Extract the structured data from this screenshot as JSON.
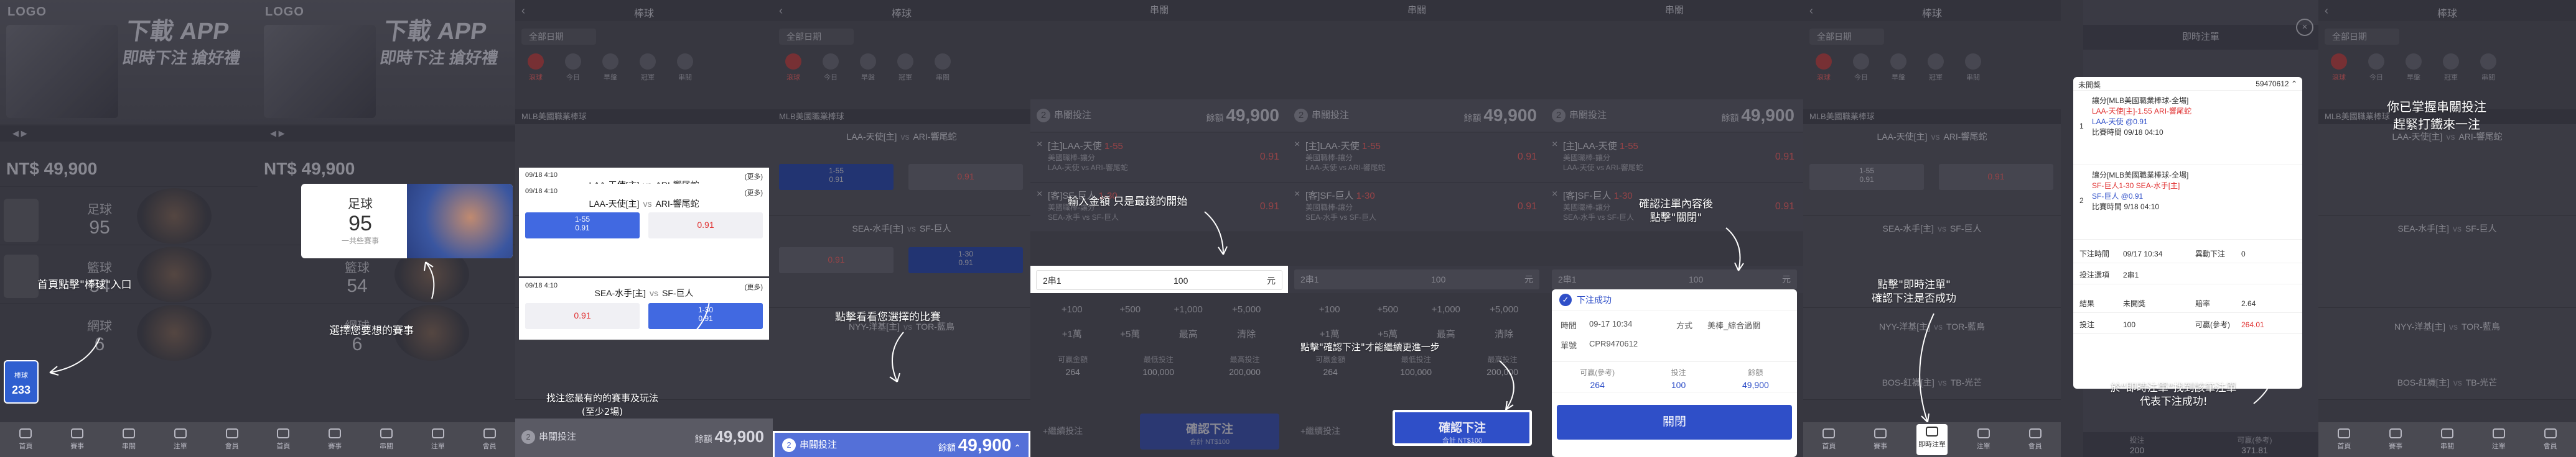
{
  "home": {
    "logo": "LOGO",
    "banner_line1": "下載 APP",
    "banner_line2": "即時下注 搶好禮",
    "balance": "NT$ 49,900",
    "categories": [
      {
        "name": "足球",
        "count": "95"
      },
      {
        "name": "籃球",
        "count": "54"
      },
      {
        "name": "網球",
        "count": "6"
      }
    ],
    "side_tab_label": "棒球",
    "side_tab_count": "233",
    "nav": [
      "首頁",
      "賽事",
      "串關",
      "注單",
      "會員"
    ],
    "popup": {
      "name": "足球",
      "count": "95",
      "sub": "一共些賽事"
    }
  },
  "annotations": {
    "a1": "首頁點擊\"棒球\"入口",
    "a2": "選擇您要想的賽事",
    "a3_line1": "找注您最有的的賽事及玩法",
    "a3_line2": "(至少2場)",
    "a4": "點擊看看您選擇的比賽",
    "a5": "輸入金額 只是最錢的開始",
    "a6": "點擊\"確認下注\"才能繼續更進一步",
    "a7_line1": "確認注單內容後",
    "a7_line2": "點擊\"關閉\"",
    "a8_line1": "點擊\"即時注單\"",
    "a8_line2": "確認下注是否成功",
    "a9_line1": "於\"即時注單\"找到該筆注單",
    "a9_line2": "代表下注成功!",
    "a10_line1": "你已掌握串關投注",
    "a10_line2": "趕緊打鐵來一注"
  },
  "sport": {
    "title": "棒球",
    "filter": "全部日期",
    "leagues": [
      "滾球",
      "今日",
      "早盤",
      "冠軍",
      "串關"
    ],
    "section": "MLB美國職業棒球",
    "match1": {
      "time": "09/18 4:10",
      "more": "(更多)",
      "home": "LAA-天使[主]",
      "away": "ARI-響尾蛇",
      "odds_a": "1-55",
      "odds_a_price": "0.91",
      "odds_b_price": "0.91"
    },
    "match2": {
      "time": "09/18 4:10",
      "more": "(更多)",
      "home": "SEA-水手[主]",
      "away": "SF-巨人",
      "odds_a_price": "0.91",
      "odds_b": "1-30",
      "odds_b_price": "0.91"
    },
    "match3": {
      "home": "NYY-洋基[主]",
      "away": "TOR-藍鳥"
    },
    "match4": {
      "home": "BOS-紅襪[主]",
      "away": "TB-光芒"
    },
    "slip_count": "2",
    "slip_label": "串關投注",
    "slip_amount_label": "餘額",
    "slip_amount": "49,900"
  },
  "slip": {
    "header": "串關",
    "count": "2",
    "label": "串關投注",
    "amount_label": "餘額",
    "amount": "49,900",
    "legs": [
      {
        "team": "[主]LAA-天使",
        "line": "1-55",
        "market": "美國職棒-讓分",
        "match": "LAA-天使 vs ARI-響尾蛇",
        "odds": "0.91"
      },
      {
        "team": "[客]SF-巨人",
        "line": "1-30",
        "market": "美國職棒-讓分",
        "match": "SEA-水手 vs SF-巨人",
        "odds": "0.91"
      }
    ],
    "stake_type": "2串1",
    "stake_value": "100",
    "stake_unit": "元",
    "quick": [
      "+100",
      "+500",
      "+1,000",
      "+5,000",
      "+1萬",
      "+5萬",
      "最高",
      "清除"
    ],
    "summary": [
      {
        "k": "可贏金額",
        "v": "264"
      },
      {
        "k": "最低投注",
        "v": "100,000"
      },
      {
        "k": "最高投注",
        "v": "200,000"
      }
    ],
    "confirm": "確認下注",
    "confirm_sub": "合計 NT$100",
    "more_link": "+繼續投注"
  },
  "dialog": {
    "title": "下注成功",
    "time_label": "時間",
    "time": "09-17 10:34",
    "method_label": "方式",
    "method": "美棒_綜合過關",
    "id_label": "單號",
    "id": "CPR9470612",
    "stats": [
      {
        "k": "可贏(參考)",
        "v": "264"
      },
      {
        "k": "投注",
        "v": "100"
      },
      {
        "k": "餘額",
        "v": "49,900"
      }
    ],
    "close": "關閉"
  },
  "mybets": {
    "header": "即時注單",
    "nav_label": "即時注單",
    "card_title": "未開獎",
    "card_id": "59470612",
    "legs": [
      {
        "n": "1",
        "l1": "讓分[MLB美國職業棒球-全場]",
        "l2": "LAA-天使[主]-1.55 ARI-響尾蛇",
        "l3": "LAA-天使 @0.91",
        "l4": "比賽時間 09/18 04:10"
      },
      {
        "n": "2",
        "l1": "讓分[MLB美國職業棒球-全場]",
        "l2": "SF-巨人1-30 SEA-水手[主]",
        "l3": "SF-巨人 @0.91",
        "l4": "比賽時間 9/18 04:10"
      }
    ],
    "rows": [
      {
        "k1": "下注時間",
        "v1": "09/17 10:34",
        "k2": "異動下注",
        "v2": "0"
      },
      {
        "k1": "投注選項",
        "v1": "2串1",
        "k2": "",
        "v2": ""
      },
      {
        "k1": "結果",
        "v1": "未開獎",
        "k2": "賠率",
        "v2": "2.64"
      },
      {
        "k1": "投注",
        "v1": "100",
        "k2": "可贏(參考)",
        "v2": "264.01"
      }
    ],
    "foot": [
      {
        "k": "投注",
        "v": "200"
      },
      {
        "k": "可贏(參考)",
        "v": "371.81"
      }
    ]
  }
}
